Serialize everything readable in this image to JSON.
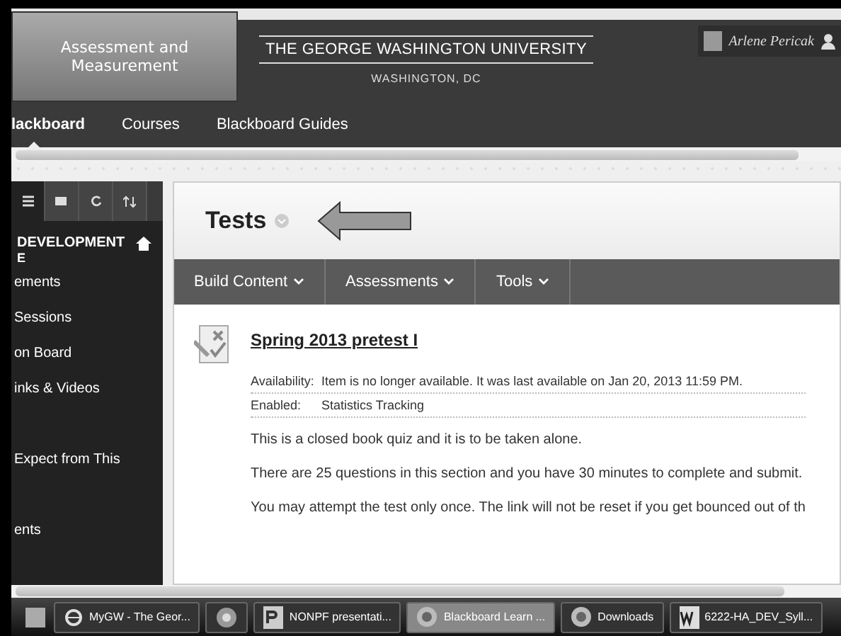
{
  "callout": {
    "text": "Assessment and Measurement"
  },
  "header": {
    "university": "THE GEORGE WASHINGTON UNIVERSITY",
    "location": "WASHINGTON, DC",
    "user": "Arlene Pericak"
  },
  "nav_tabs": [
    {
      "label": "lackboard",
      "selected": true
    },
    {
      "label": "Courses",
      "selected": false
    },
    {
      "label": "Blackboard Guides",
      "selected": false
    }
  ],
  "sidebar": {
    "tool_tabs": [
      {
        "kind": "list",
        "selected": true
      },
      {
        "kind": "folder",
        "selected": false
      },
      {
        "kind": "refresh",
        "selected": false
      },
      {
        "kind": "sort",
        "selected": false
      }
    ],
    "course_title": "DEVELOPMENT",
    "course_title_2": "E",
    "items": [
      {
        "label": "ements",
        "gap_before": false
      },
      {
        "label": "Sessions",
        "gap_before": false
      },
      {
        "label": "on Board",
        "gap_before": false
      },
      {
        "label": "inks & Videos",
        "gap_before": false
      },
      {
        "label": "Expect from This",
        "gap_before": true
      },
      {
        "label": "ents",
        "gap_before": true
      }
    ]
  },
  "page": {
    "title": "Tests",
    "action_bar": [
      "Build Content",
      "Assessments",
      "Tools"
    ],
    "item": {
      "title": "Spring 2013 pretest I",
      "details": [
        {
          "label": "Availability:",
          "value": "Item is no longer available. It was last available on Jan 20, 2013 11:59 PM."
        },
        {
          "label": "Enabled:",
          "value": "Statistics Tracking"
        }
      ],
      "paragraphs": [
        "This is a closed book quiz and it is to be taken alone.",
        "There are 25 questions in this section and you have 30 minutes to complete and submit.",
        "You may attempt the test only once. The link will not be reset if you get bounced out of th"
      ]
    }
  },
  "taskbar": [
    {
      "kind": "ie",
      "label": "MyGW - The Geor...",
      "selected": false
    },
    {
      "kind": "chrome",
      "selected": false
    },
    {
      "kind": "ppt",
      "label": "NONPF presentati...",
      "selected": false
    },
    {
      "kind": "firefox",
      "label": "Blackboard Learn ...",
      "selected": true
    },
    {
      "kind": "firefox",
      "label": "Downloads",
      "selected": false
    },
    {
      "kind": "word",
      "label": "6222-HA_DEV_Syll...",
      "selected": false
    }
  ]
}
